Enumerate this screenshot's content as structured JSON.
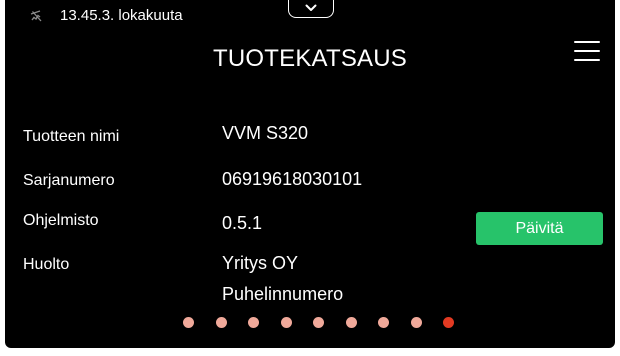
{
  "status_bar": {
    "icon": "no-connection-icon",
    "text": "13.45.3. lokakuuta"
  },
  "header": {
    "title": "TUOTEKATSAUS",
    "menu_icon": "hamburger-menu-icon",
    "pull_tab_icon": "chevron-down-icon"
  },
  "details": {
    "product_name": {
      "label": "Tuotteen nimi",
      "value": "VVM S320"
    },
    "serial_number": {
      "label": "Sarjanumero",
      "value": "06919618030101"
    },
    "software": {
      "label": "Ohjelmisto",
      "value": "0.5.1"
    },
    "service": {
      "label": "Huolto",
      "value": "Yritys OY",
      "value2": "Puhelinnumero"
    }
  },
  "update_button": {
    "label": "Päivitä"
  },
  "pagination": {
    "total": 9,
    "active_index": 8,
    "colors": {
      "inactive": "#f0a99a",
      "active": "#e23a22"
    }
  },
  "colors": {
    "background": "#000000",
    "text": "#ffffff",
    "accent_button": "#27c36a"
  }
}
